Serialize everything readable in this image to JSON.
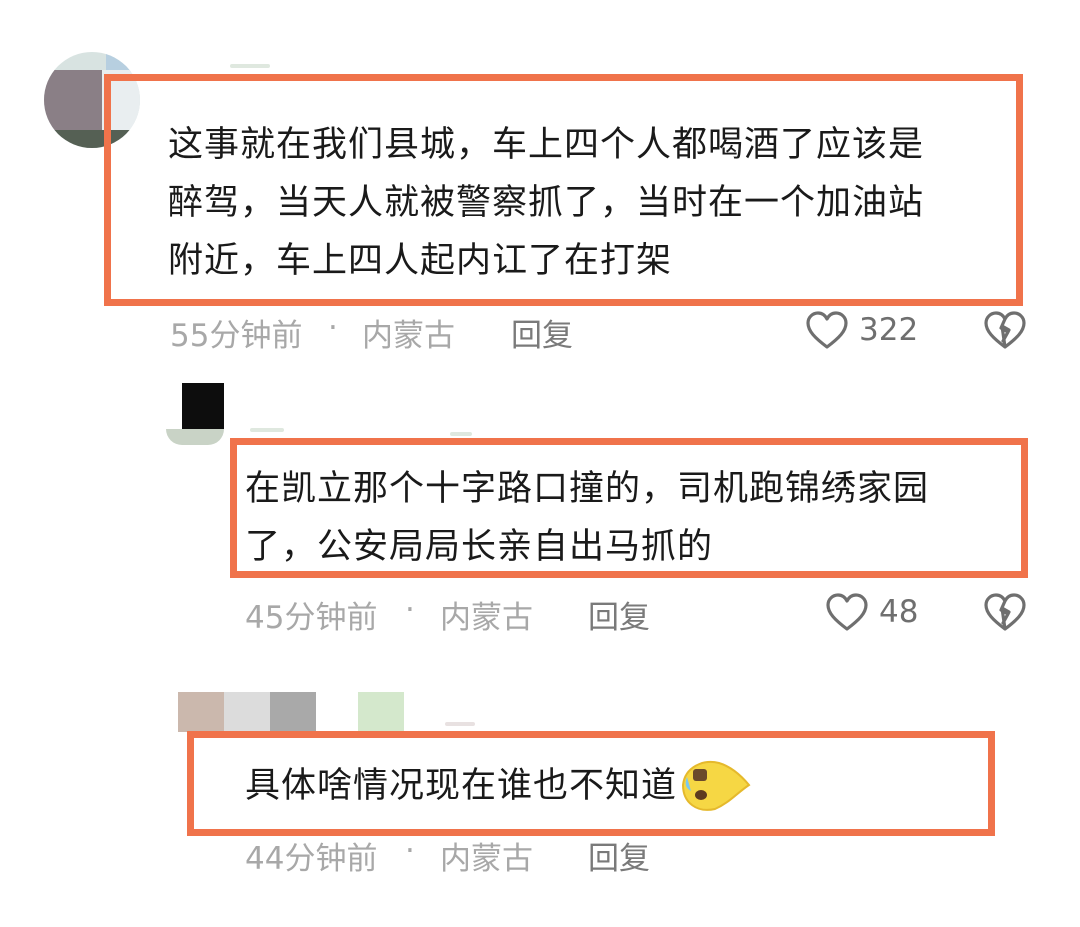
{
  "comments": [
    {
      "text_lines": [
        "这事就在我们县城，车上四个人都喝酒了应该是",
        "醉驾，当天人就被警察抓了，当时在一个加油站",
        "附近，车上四人起内讧了在打架"
      ],
      "time": "55分钟前",
      "separator": "·",
      "location": "内蒙古",
      "reply": "回复",
      "likes": "322"
    },
    {
      "text_lines": [
        "在凯立那个十字路口撞的，司机跑锦绣家园",
        "了，公安局局长亲自出马抓的"
      ],
      "time": "45分钟前",
      "separator": "·",
      "location": "内蒙古",
      "reply": "回复",
      "likes": "48"
    },
    {
      "text_lines": [
        "具体啥情况现在谁也不知道"
      ],
      "emoji_icon": "crying-emoji-icon",
      "time": "44分钟前",
      "separator": "·",
      "location": "内蒙古",
      "reply": "回复"
    }
  ],
  "colors": {
    "highlight": "#f0734b",
    "meta": "#a8a8a8",
    "text": "#1a1a1a"
  },
  "icons": {
    "like": "heart-outline-icon",
    "dislike": "broken-heart-icon"
  }
}
